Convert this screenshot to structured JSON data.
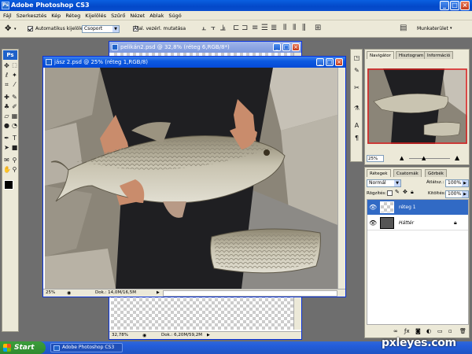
{
  "app": {
    "title": "Adobe Photoshop CS3",
    "logo": "Ps"
  },
  "menu": [
    "Fájl",
    "Szerkesztés",
    "Kép",
    "Réteg",
    "Kijelölés",
    "Szűrő",
    "Nézet",
    "Ablak",
    "Súgó"
  ],
  "options": {
    "auto_select_label": "Automatikus kijelölés:",
    "auto_select_value": "Csoport",
    "transform_label": "Átal. vezérl. mutatása",
    "workspace_label": "Munkaterület"
  },
  "documents": {
    "back": {
      "title": "pelikán2.psd @ 32,8% (réteg 6,RGB/8*)",
      "zoom": "32,78%",
      "doc_size": "Dok.: 6,20M/59,2M"
    },
    "front": {
      "title": "jász 2.psd @ 25% (réteg 1,RGB/8)",
      "zoom": "25%",
      "doc_size": "Dok.: 14,0M/16,5M"
    }
  },
  "navigator": {
    "tabs": [
      "Navigátor",
      "Hisztogram",
      "Információ"
    ],
    "zoom": "25%"
  },
  "layers": {
    "tabs": [
      "Rétegek",
      "Csatornák",
      "Görbék"
    ],
    "blend_mode": "Normál",
    "opacity_label": "Átlátsz.:",
    "opacity_value": "100%",
    "lock_label": "Rögzítés:",
    "fill_label": "Kitöltés:",
    "fill_value": "100%",
    "items": [
      {
        "name": "réteg 1"
      },
      {
        "name": "Háttér"
      }
    ]
  },
  "taskbar": {
    "start": "Start",
    "item": "Adobe Photoshop CS3"
  },
  "watermark": "pxleyes.com",
  "colors": {
    "xp_blue": "#0549d6",
    "panel_bg": "#ece9d8",
    "layer_selected": "#316ac5",
    "start_green": "#2f8a2f"
  }
}
